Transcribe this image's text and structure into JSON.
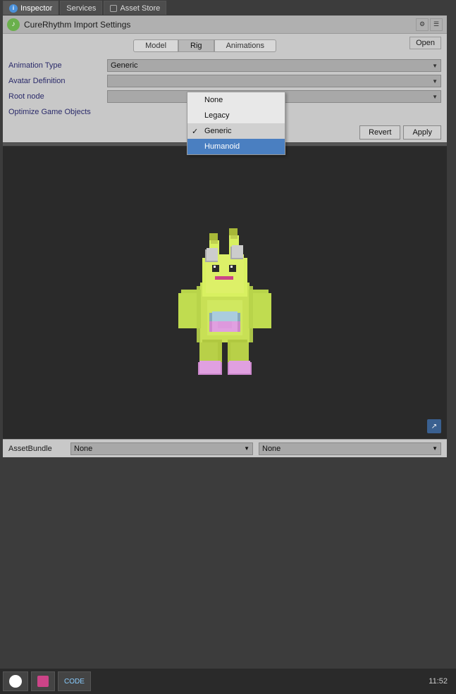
{
  "tabs": {
    "inspector": {
      "label": "Inspector",
      "active": true
    },
    "services": {
      "label": "Services",
      "active": false
    },
    "asset_store": {
      "label": "Asset Store",
      "active": false
    }
  },
  "header": {
    "title": "CureRhythm Import Settings",
    "icon_color": "#6ab04c",
    "open_button": "Open"
  },
  "import_tabs": {
    "model": {
      "label": "Model"
    },
    "rig": {
      "label": "Rig",
      "active": true
    },
    "animations": {
      "label": "Animations"
    }
  },
  "fields": {
    "animation_type": {
      "label": "Animation Type",
      "value": "Generic"
    },
    "avatar_definition": {
      "label": "Avatar Definition",
      "value": ""
    },
    "root_node": {
      "label": "Root node",
      "value": ""
    },
    "optimize_game_objects": {
      "label": "Optimize Game Objects",
      "value": ""
    }
  },
  "dropdown": {
    "options": [
      {
        "value": "None",
        "selected": false,
        "highlighted": false
      },
      {
        "value": "Legacy",
        "selected": false,
        "highlighted": false
      },
      {
        "value": "Generic",
        "selected": true,
        "highlighted": false
      },
      {
        "value": "Humanoid",
        "selected": false,
        "highlighted": true
      }
    ]
  },
  "buttons": {
    "revert": "Revert",
    "apply": "Apply"
  },
  "asset_bundle": {
    "label": "AssetBundle",
    "options_left": [
      "None"
    ],
    "options_right": [
      "None"
    ],
    "selected_left": "None",
    "selected_right": "None"
  },
  "taskbar": {
    "items": [
      {
        "label": "Unity icon",
        "type": "unity"
      },
      {
        "label": "App 2",
        "type": "app"
      },
      {
        "label": "Code",
        "type": "code"
      }
    ],
    "clock": "11:52"
  }
}
